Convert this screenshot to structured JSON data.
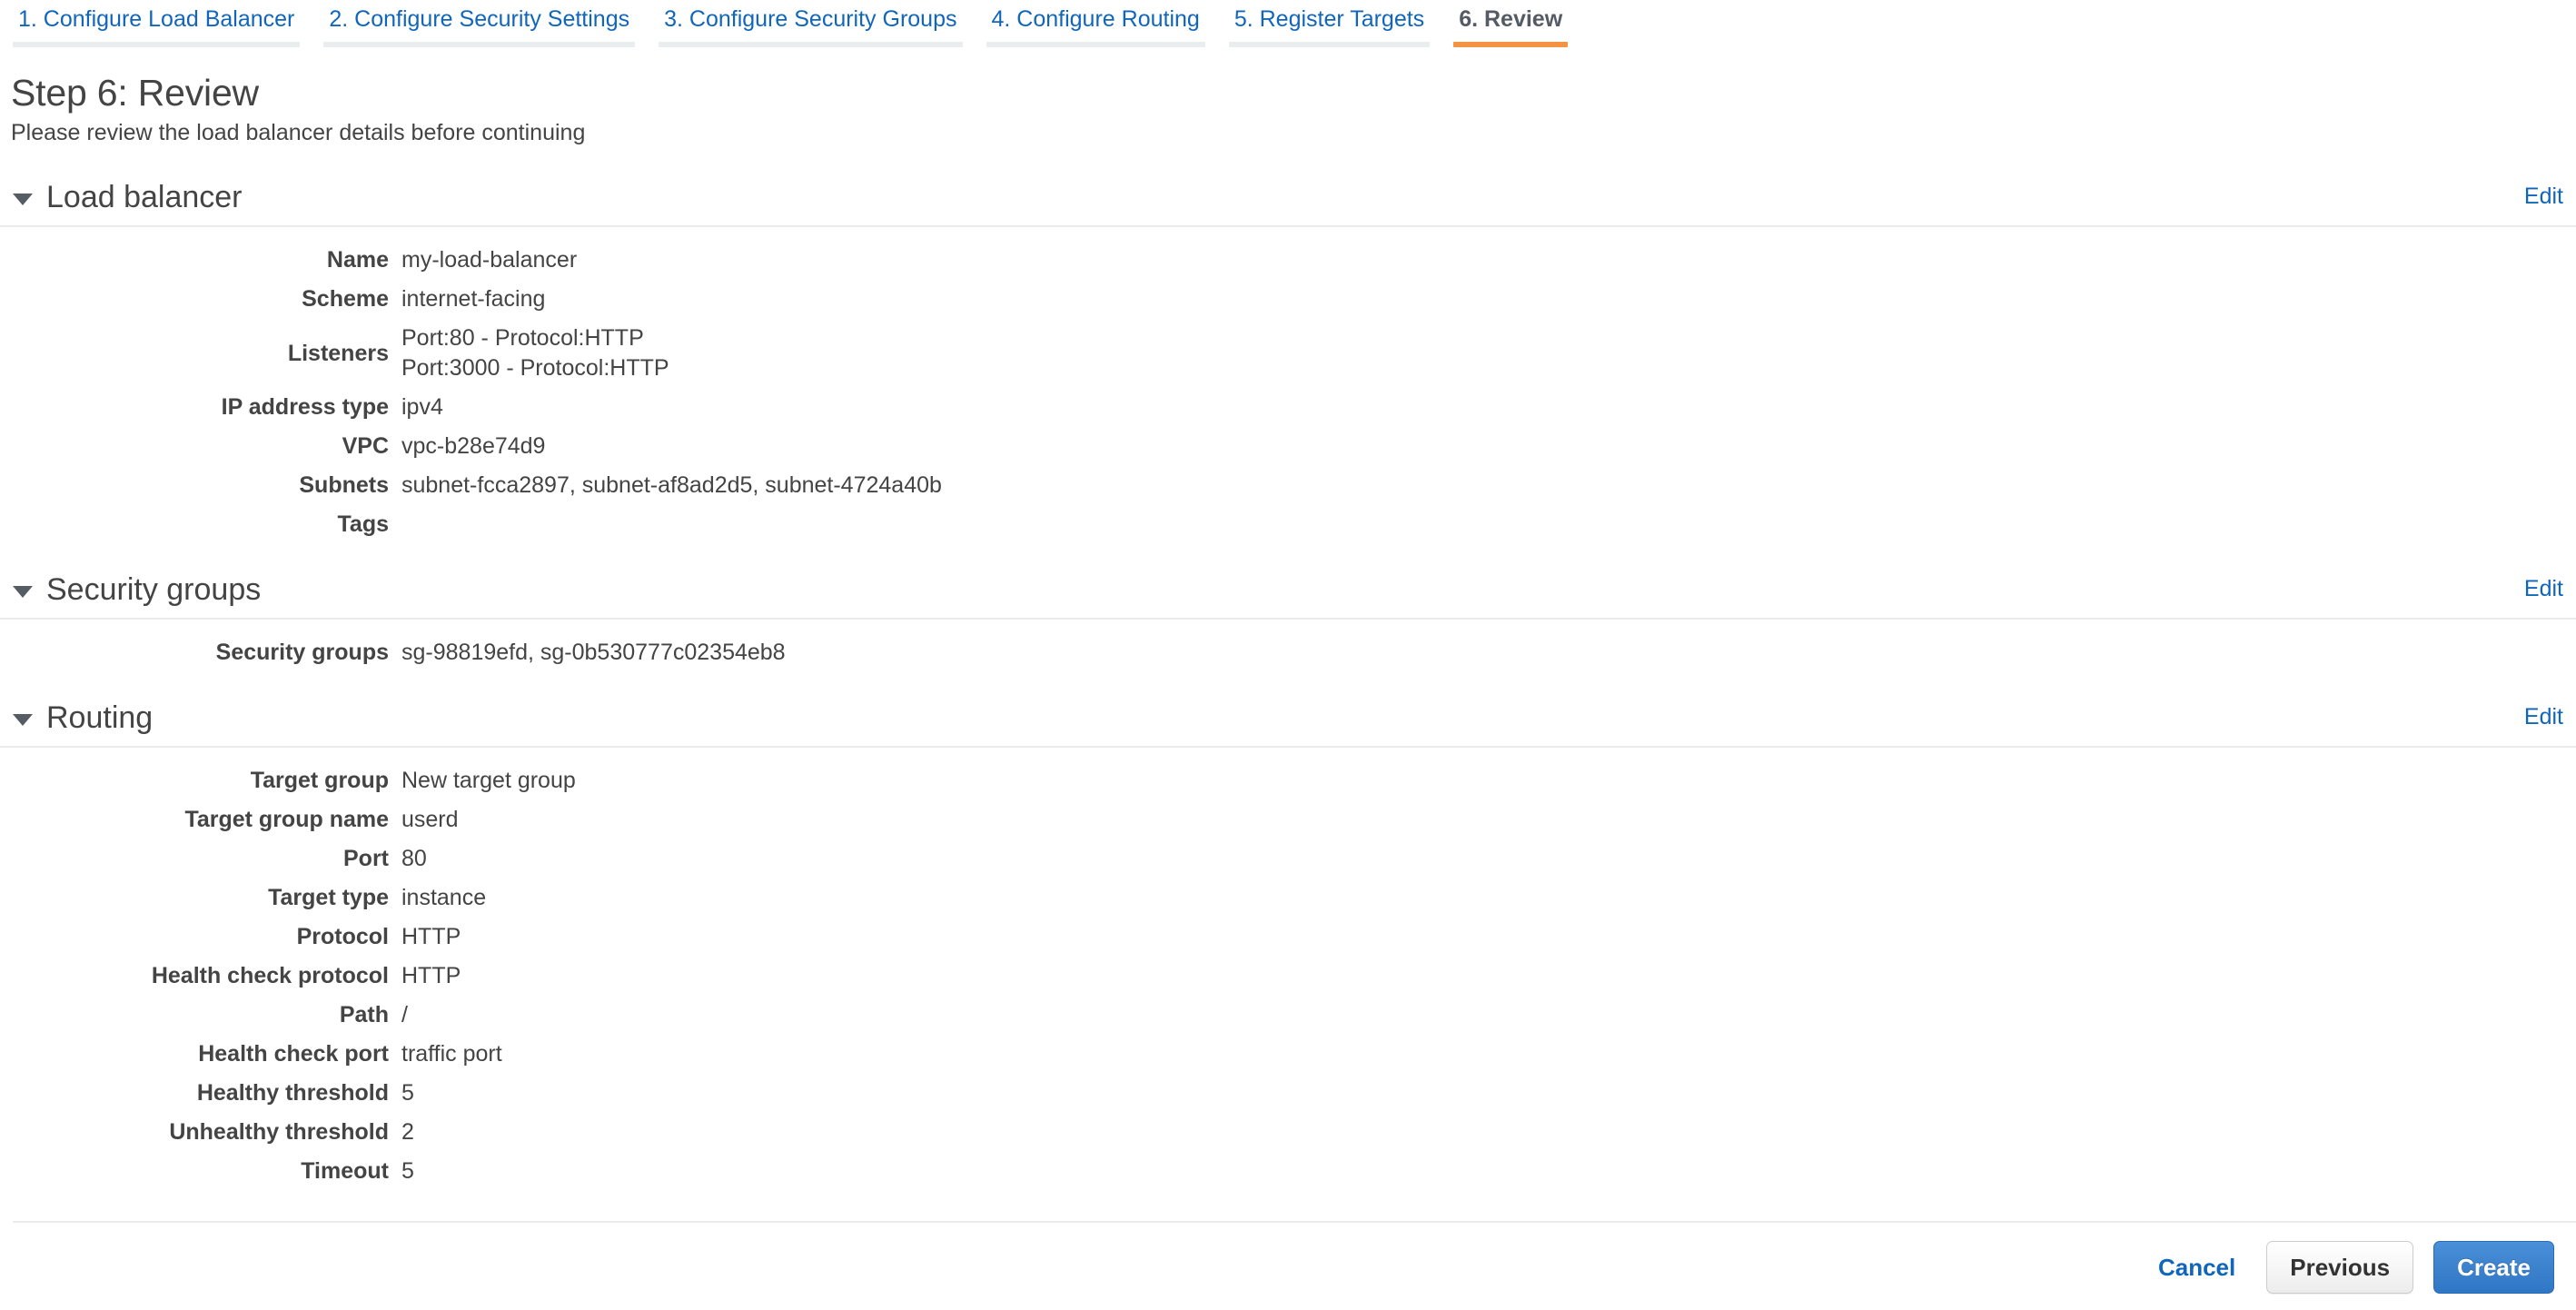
{
  "wizard": {
    "tabs": [
      {
        "label": "1. Configure Load Balancer",
        "active": false
      },
      {
        "label": "2. Configure Security Settings",
        "active": false
      },
      {
        "label": "3. Configure Security Groups",
        "active": false
      },
      {
        "label": "4. Configure Routing",
        "active": false
      },
      {
        "label": "5. Register Targets",
        "active": false
      },
      {
        "label": "6. Review",
        "active": true
      }
    ]
  },
  "page": {
    "title": "Step 6: Review",
    "subtitle": "Please review the load balancer details before continuing"
  },
  "sections": [
    {
      "title": "Load balancer",
      "edit_label": "Edit",
      "rows": [
        {
          "label": "Name",
          "value": "my-load-balancer"
        },
        {
          "label": "Scheme",
          "value": "internet-facing"
        },
        {
          "label": "Listeners",
          "value": "Port:80 - Protocol:HTTP\nPort:3000 - Protocol:HTTP"
        },
        {
          "label": "IP address type",
          "value": "ipv4"
        },
        {
          "label": "VPC",
          "value": "vpc-b28e74d9"
        },
        {
          "label": "Subnets",
          "value": "subnet-fcca2897, subnet-af8ad2d5, subnet-4724a40b"
        },
        {
          "label": "Tags",
          "value": ""
        }
      ]
    },
    {
      "title": "Security groups",
      "edit_label": "Edit",
      "rows": [
        {
          "label": "Security groups",
          "value": "sg-98819efd, sg-0b530777c02354eb8"
        }
      ]
    },
    {
      "title": "Routing",
      "edit_label": "Edit",
      "rows": [
        {
          "label": "Target group",
          "value": "New target group"
        },
        {
          "label": "Target group name",
          "value": "userd"
        },
        {
          "label": "Port",
          "value": "80"
        },
        {
          "label": "Target type",
          "value": "instance"
        },
        {
          "label": "Protocol",
          "value": "HTTP"
        },
        {
          "label": "Health check protocol",
          "value": "HTTP"
        },
        {
          "label": "Path",
          "value": "/"
        },
        {
          "label": "Health check port",
          "value": "traffic port"
        },
        {
          "label": "Healthy threshold",
          "value": "5"
        },
        {
          "label": "Unhealthy threshold",
          "value": "2"
        },
        {
          "label": "Timeout",
          "value": "5"
        }
      ]
    }
  ],
  "footer": {
    "cancel_label": "Cancel",
    "previous_label": "Previous",
    "create_label": "Create"
  },
  "colors": {
    "link": "#1166bb",
    "active_tab_underline": "#f49342",
    "primary_button": "#3d82cd",
    "text": "#444444"
  }
}
